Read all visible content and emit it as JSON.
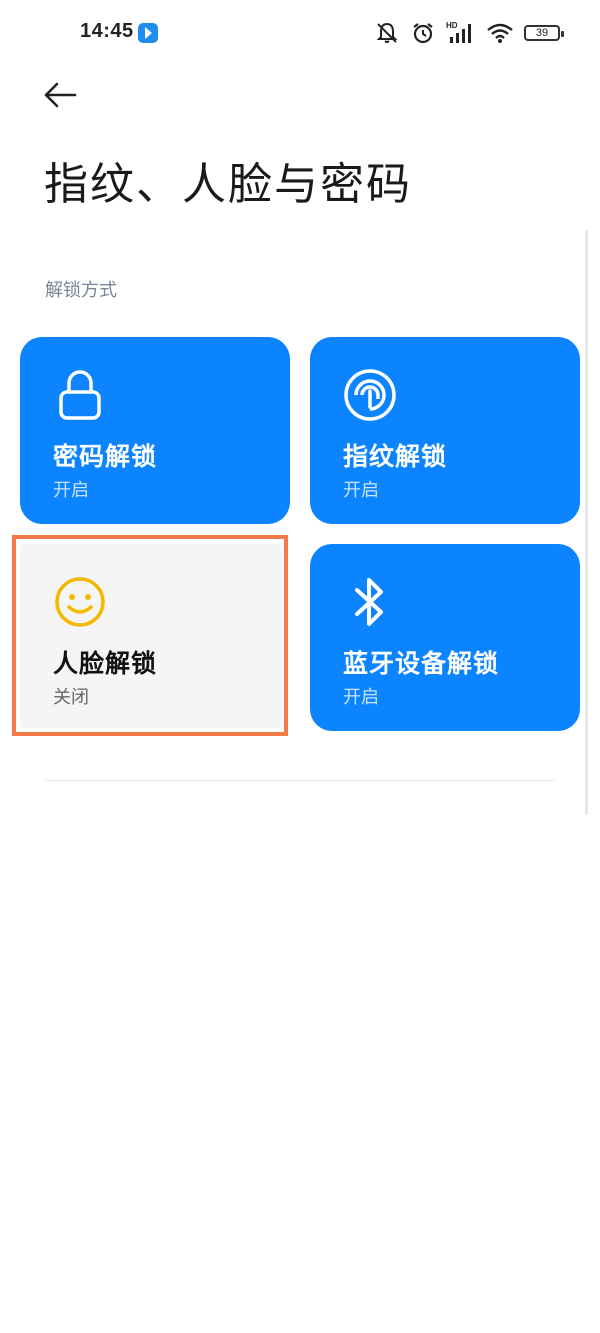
{
  "status_bar": {
    "time": "14:45",
    "battery": "39",
    "icons": [
      "mute-icon",
      "alarm-icon",
      "hd-signal-icon",
      "wifi-icon",
      "battery-icon"
    ]
  },
  "header": {
    "back_icon": "arrow-left-icon",
    "title": "指纹、人脸与密码"
  },
  "section": {
    "label": "解锁方式"
  },
  "cards": [
    {
      "title": "密码解锁",
      "status": "开启",
      "icon": "lock-icon",
      "state": "on"
    },
    {
      "title": "指纹解锁",
      "status": "开启",
      "icon": "fingerprint-icon",
      "state": "on"
    },
    {
      "title": "人脸解锁",
      "status": "关闭",
      "icon": "smiley-face-icon",
      "state": "off"
    },
    {
      "title": "蓝牙设备解锁",
      "status": "开启",
      "icon": "bluetooth-icon",
      "state": "on"
    }
  ],
  "colors": {
    "accent": "#0d84ff",
    "card_off": "#f5f5f5",
    "face_icon": "#f5b800",
    "highlight": "#f47a4a"
  }
}
